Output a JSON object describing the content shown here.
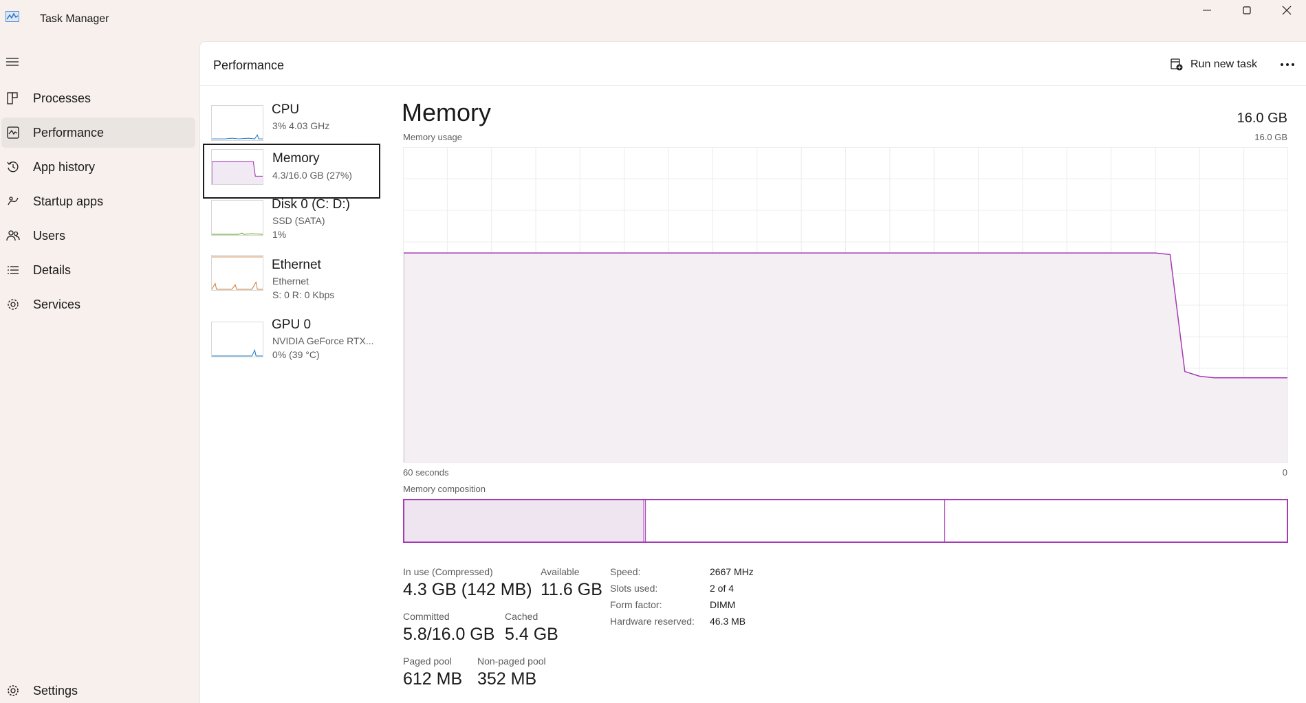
{
  "window": {
    "title": "Task Manager",
    "controls": [
      "minimize",
      "maximize",
      "close"
    ]
  },
  "sidebar": {
    "items": [
      {
        "label": "Processes",
        "icon": "processes-icon"
      },
      {
        "label": "Performance",
        "icon": "performance-icon",
        "active": true
      },
      {
        "label": "App history",
        "icon": "history-icon"
      },
      {
        "label": "Startup apps",
        "icon": "startup-icon"
      },
      {
        "label": "Users",
        "icon": "users-icon"
      },
      {
        "label": "Details",
        "icon": "details-icon"
      },
      {
        "label": "Services",
        "icon": "services-icon"
      }
    ],
    "settings_label": "Settings"
  },
  "header": {
    "title": "Performance",
    "run_task_label": "Run new task"
  },
  "devices": [
    {
      "name": "CPU",
      "line1": "3%  4.03 GHz",
      "line2": ""
    },
    {
      "name": "Memory",
      "line1": "4.3/16.0 GB (27%)",
      "line2": "",
      "selected": true
    },
    {
      "name": "Disk 0 (C: D:)",
      "line1": "SSD (SATA)",
      "line2": "1%"
    },
    {
      "name": "Ethernet",
      "line1": "Ethernet",
      "line2": "S: 0 R: 0 Kbps"
    },
    {
      "name": "GPU 0",
      "line1": "NVIDIA GeForce RTX...",
      "line2": "0%  (39 °C)"
    }
  ],
  "memory": {
    "title": "Memory",
    "total": "16.0 GB",
    "usage_label": "Memory usage",
    "usage_max": "16.0 GB",
    "time_left": "60 seconds",
    "time_right": "0",
    "composition_label": "Memory composition",
    "usage_fraction_history": [
      0.665,
      0.665,
      0.665,
      0.665,
      0.665,
      0.665,
      0.665,
      0.665,
      0.665,
      0.665,
      0.665,
      0.665,
      0.665,
      0.665,
      0.665,
      0.665,
      0.665,
      0.665,
      0.665,
      0.665,
      0.665,
      0.665,
      0.665,
      0.665,
      0.665,
      0.665,
      0.665,
      0.665,
      0.665,
      0.665,
      0.665,
      0.665,
      0.665,
      0.665,
      0.665,
      0.665,
      0.665,
      0.665,
      0.665,
      0.665,
      0.665,
      0.665,
      0.665,
      0.665,
      0.665,
      0.665,
      0.665,
      0.665,
      0.665,
      0.665,
      0.665,
      0.665,
      0.66,
      0.29,
      0.275,
      0.27,
      0.27,
      0.27,
      0.27,
      0.27,
      0.27
    ],
    "composition": {
      "in_use": 0.272,
      "modified": 0.002,
      "standby": 0.338,
      "free": 0.388
    },
    "stats": {
      "in_use_label": "In use (Compressed)",
      "in_use_value": "4.3 GB (142 MB)",
      "available_label": "Available",
      "available_value": "11.6 GB",
      "committed_label": "Committed",
      "committed_value": "5.8/16.0 GB",
      "cached_label": "Cached",
      "cached_value": "5.4 GB",
      "paged_label": "Paged pool",
      "paged_value": "612 MB",
      "nonpaged_label": "Non-paged pool",
      "nonpaged_value": "352 MB"
    },
    "specs": [
      {
        "label": "Speed:",
        "value": "2667 MHz"
      },
      {
        "label": "Slots used:",
        "value": "2 of 4"
      },
      {
        "label": "Form factor:",
        "value": "DIMM"
      },
      {
        "label": "Hardware reserved:",
        "value": "46.3 MB"
      }
    ]
  },
  "colors": {
    "accent": "#a53ab6",
    "fill": "#f4eff3",
    "grid": "#ececec"
  }
}
